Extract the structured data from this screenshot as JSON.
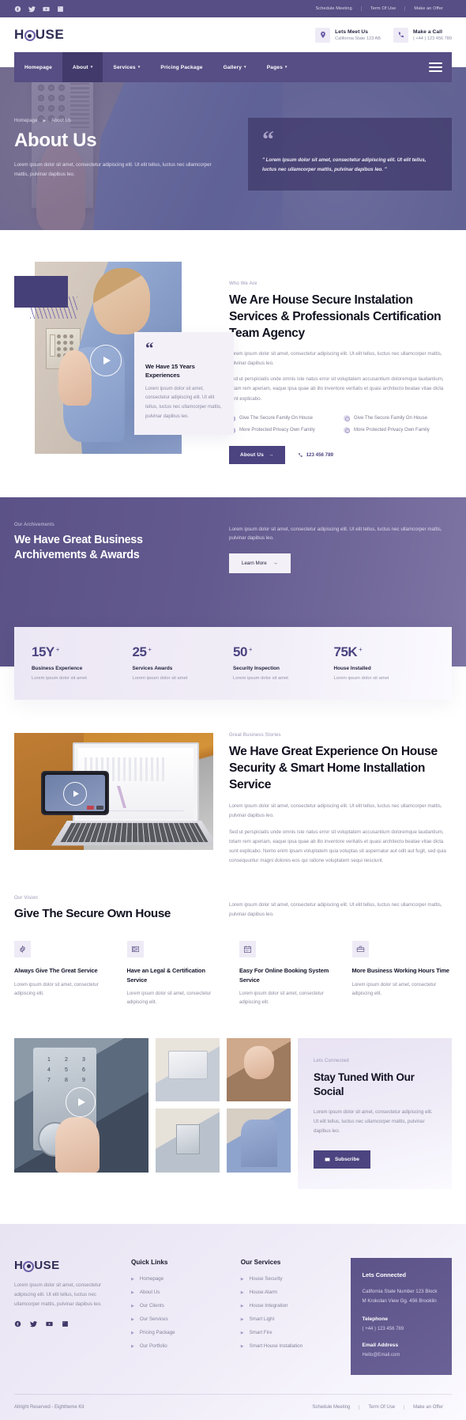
{
  "brand": {
    "name_pre": "H",
    "name_post": "USE",
    "full": "HOUSE"
  },
  "topbar": {
    "links": [
      "Schedule Meeting",
      "Term Of Use",
      "Make an Offer"
    ],
    "social": [
      "facebook-icon",
      "twitter-icon",
      "youtube-icon",
      "linkedin-icon"
    ]
  },
  "header": {
    "meet": {
      "title": "Lets Meet Us",
      "sub": "California State 123 AB",
      "icon": "location-pin-icon"
    },
    "call": {
      "title": "Make a Call",
      "sub": "( +44 ) 123 456 789",
      "icon": "telephone-icon"
    }
  },
  "nav": {
    "items": [
      {
        "label": "Homepage",
        "caret": false,
        "active": false
      },
      {
        "label": "About",
        "caret": true,
        "active": true
      },
      {
        "label": "Services",
        "caret": true,
        "active": false
      },
      {
        "label": "Pricing Package",
        "caret": false,
        "active": false
      },
      {
        "label": "Gallery",
        "caret": true,
        "active": false
      },
      {
        "label": "Pages",
        "caret": true,
        "active": false
      }
    ]
  },
  "hero": {
    "breadcrumb_home": "Homepage",
    "breadcrumb_current": "About Us",
    "title": "About Us",
    "desc": "Lorem ipsum dolor sit amet, consectetur adipiscing elit. Ut elit tellus, luctus nec ullamcorper mattis, pulvinar dapibus leo.",
    "quote": "\" Lorem ipsum dolor sit amet, consectetur adipiscing elit. Ut elit tellus, luctus nec ullamcorper mattis, pulvinar dapibus leo. \""
  },
  "whowe": {
    "eyebrow": "Who We Are",
    "title": "We Are House Secure Instalation Services & Professionals Certification Team Agency",
    "p1": "Lorem ipsum dolor sit amet, consectetur adipiscing elit. Ut elit tellus, luctus nec ullamcorper mattis, pulvinar dapibus leo.",
    "p2": "Sed ut perspiciatis unde omnis iste natus error sit voluptatem accusantium doloremque laudantium, totam rem aperiam, eaque ipsa quae ab illo inventore veritatis et quasi architecto beatae vitae dicta sunt explicabo.",
    "ticks": [
      "Give The Secure Family On House",
      "Give The Secure Family On House",
      "More Protected Privacy Own Family",
      "More Protected Privacy Own Family"
    ],
    "button": "About Us",
    "button_arrow": "→",
    "phone": "123 456 789",
    "card": {
      "title": "We Have 15 Years Experiences",
      "desc": "Lorem ipsum dolor sit amet, consectetur adipiscing elit. Ut elit tellus, luctus nec ullamcorper mattis, pulvinar dapibus leo."
    }
  },
  "achievements": {
    "eyebrow": "Our Archivements",
    "title": "We Have Great Business Archivements & Awards",
    "desc": "Lorem ipsum dolor sit amet, consectetur adipiscing elit. Ut elit tellus, luctus nec ullamcorper mattis, pulvinar dapibus leo.",
    "button": "Learn More",
    "button_arrow": "→",
    "stats": [
      {
        "num": "15Y",
        "plus": "+",
        "label": "Business Experience",
        "sub": "Lorem ipsum dolor sit amet"
      },
      {
        "num": "25",
        "plus": "+",
        "label": "Services Awards",
        "sub": "Lorem ipsum dolor sit amet"
      },
      {
        "num": "50",
        "plus": "+",
        "label": "Security Inspection",
        "sub": "Lorem ipsum dolor sit amet"
      },
      {
        "num": "75K",
        "plus": "+",
        "label": "House Installed",
        "sub": "Lorem ipsum dolor sit amet"
      }
    ]
  },
  "stories": {
    "eyebrow": "Great Business Stories",
    "title": "We Have Great Experience On House Security & Smart Home Installation Service",
    "p1": "Lorem ipsum dolor sit amet, consectetur adipiscing elit. Ut elit tellus, luctus nec ullamcorper mattis, pulvinar dapibus leo.",
    "p2": "Sed ut perspiciatis unde omnis iste natus error sit voluptatem accusantium doloremque laudantium, totam rem aperiam, eaque ipsa quae ab illo inventore veritatis et quasi architecto beatae vitae dicta sunt explicabo. Nemo enim ipsam voluptatem quia voluptas sit aspernatur aut odit aut fugit, sed quia consequuntur magni dolores eos qui ratione voluptatem sequi nesciunt."
  },
  "vision": {
    "eyebrow": "Our Vision",
    "title": "Give The Secure Own House",
    "desc": "Lorem ipsum dolor sit amet, consectetur adipiscing elit. Ut elit tellus, luctus nec ullamcorper mattis, pulvinar dapibus leo.",
    "features": [
      {
        "icon": "gear-icon",
        "title": "Always Give The Great Service",
        "desc": "Lorem ipsum dolor sit amet, consectetur adipiscing elit."
      },
      {
        "icon": "certificate-icon",
        "title": "Have an Legal & Certification Service",
        "desc": "Lorem ipsum dolor sit amet, consectetur adipiscing elit."
      },
      {
        "icon": "calendar-icon",
        "title": "Easy For Online Booking System Service",
        "desc": "Lorem ipsum dolor sit amet, consectetur adipiscing elit."
      },
      {
        "icon": "briefcase-icon",
        "title": "More Business Working Hours Time",
        "desc": "Lorem ipsum dolor sit amet, consectetur adipiscing elit."
      }
    ]
  },
  "social": {
    "eyebrow": "Lets Connected",
    "title": "Stay Tuned With Our Social",
    "desc": "Lorem ipsum dolor sit amet, consectetur adipiscing elit. Ut elit tellus, luctus nec ullamcorper mattis, pulvinar dapibus leo.",
    "button": "Subscribe",
    "gallery_keypad_numbers": [
      "1",
      "2",
      "3",
      "4",
      "5",
      "6",
      "7",
      "8",
      "9"
    ]
  },
  "footer": {
    "about": "Lorem ipsum dolor sit amet, consectetur adipiscing elit. Ut elit tellus, luctus nec ullamcorper mattis, pulvinar dapibus leo.",
    "social": [
      "facebook-icon",
      "twitter-icon",
      "youtube-icon",
      "linkedin-icon"
    ],
    "quick_links_title": "Quick Links",
    "quick_links": [
      "Homepage",
      "About Us",
      "Our Clients",
      "Our Services",
      "Pricing Package",
      "Our Portfolio"
    ],
    "services_title": "Our Services",
    "services": [
      "House Security",
      "House Alarm",
      "House Integration",
      "Smart Light",
      "Smart Fire",
      "Smart House Installation"
    ],
    "contact": {
      "title": "Lets Connected",
      "address": "California State Number 123 Block M Krokolan View Gg. 456 Brooklin",
      "phone_label": "Telephone",
      "phone_value": "( +44 ) 123 456 789",
      "email_label": "Email Address",
      "email_value": "Hello@Email.com"
    },
    "copyright": "Allright Reserved - Eightheme Kit",
    "links": [
      "Schedule Meeting",
      "Term Of Use",
      "Make an Offer"
    ]
  },
  "colors": {
    "brand_purple": "#564e84",
    "dark_purple": "#413a6b",
    "accent": "#4b4480",
    "light_lilac": "#eeebf6"
  }
}
